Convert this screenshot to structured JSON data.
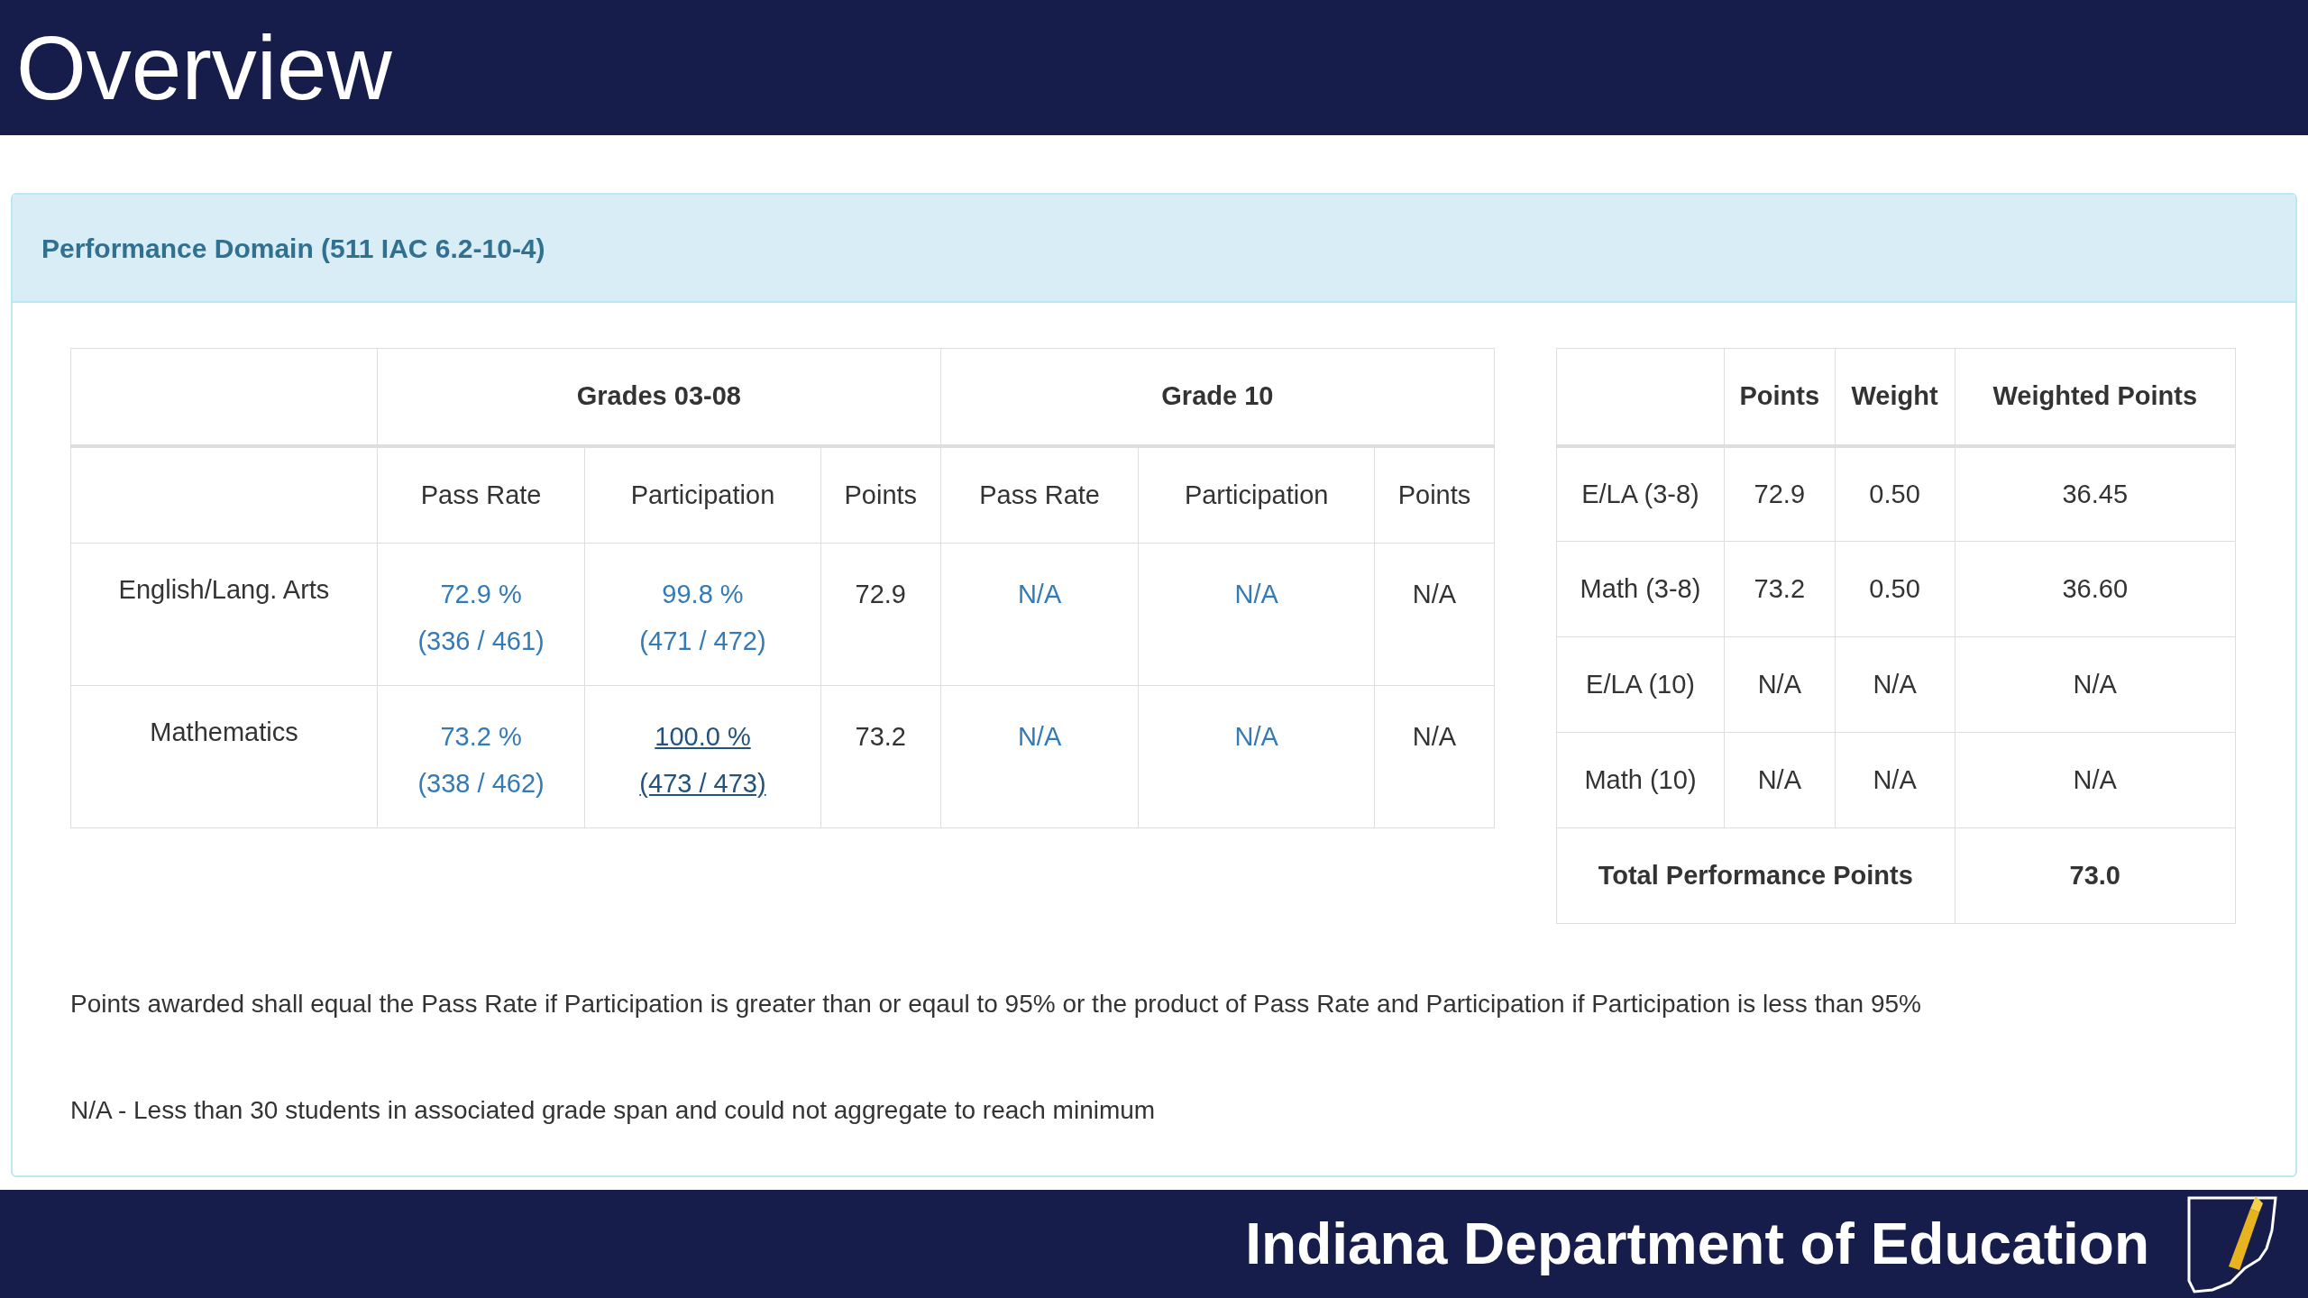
{
  "slide_title": "Overview",
  "panel": {
    "heading": "Performance Domain (511 IAC 6.2-10-4)",
    "grade_table": {
      "groups": [
        "Grades 03-08",
        "Grade 10"
      ],
      "columns": [
        "Pass Rate",
        "Participation",
        "Points",
        "Pass Rate",
        "Participation",
        "Points"
      ],
      "rows": [
        {
          "subject": "English/Lang. Arts",
          "cells": [
            {
              "kind": "link",
              "lines": [
                "72.9 %",
                "(336 / 461)"
              ],
              "hovered": false
            },
            {
              "kind": "link",
              "lines": [
                "99.8 %",
                "(471 / 472)"
              ],
              "hovered": false
            },
            {
              "kind": "text",
              "lines": [
                "72.9"
              ]
            },
            {
              "kind": "link",
              "lines": [
                "N/A"
              ],
              "hovered": false
            },
            {
              "kind": "link",
              "lines": [
                "N/A"
              ],
              "hovered": false
            },
            {
              "kind": "text",
              "lines": [
                "N/A"
              ]
            }
          ]
        },
        {
          "subject": "Mathematics",
          "cells": [
            {
              "kind": "link",
              "lines": [
                "73.2 %",
                "(338 / 462)"
              ],
              "hovered": false
            },
            {
              "kind": "link",
              "lines": [
                "100.0 %",
                "(473 / 473)"
              ],
              "hovered": true
            },
            {
              "kind": "text",
              "lines": [
                "73.2"
              ]
            },
            {
              "kind": "link",
              "lines": [
                "N/A"
              ],
              "hovered": false
            },
            {
              "kind": "link",
              "lines": [
                "N/A"
              ],
              "hovered": false
            },
            {
              "kind": "text",
              "lines": [
                "N/A"
              ]
            }
          ]
        }
      ]
    },
    "points_table": {
      "columns": [
        "Points",
        "Weight",
        "Weighted Points"
      ],
      "rows": [
        {
          "label": "E/LA (3-8)",
          "values": [
            "72.9",
            "0.50",
            "36.45"
          ]
        },
        {
          "label": "Math (3-8)",
          "values": [
            "73.2",
            "0.50",
            "36.60"
          ]
        },
        {
          "label": "E/LA (10)",
          "values": [
            "N/A",
            "N/A",
            "N/A"
          ]
        },
        {
          "label": "Math (10)",
          "values": [
            "N/A",
            "N/A",
            "N/A"
          ]
        }
      ],
      "total": {
        "label": "Total Performance Points",
        "value": "73.0"
      }
    },
    "notes": [
      "Points awarded shall equal the Pass Rate if Participation is greater than or eqaul to 95% or the product of Pass Rate and Participation if Participation is less than 95%",
      "N/A - Less than 30 students in associated grade span and could not aggregate to reach minimum"
    ]
  },
  "footer": {
    "organization": "Indiana Department of Education"
  }
}
